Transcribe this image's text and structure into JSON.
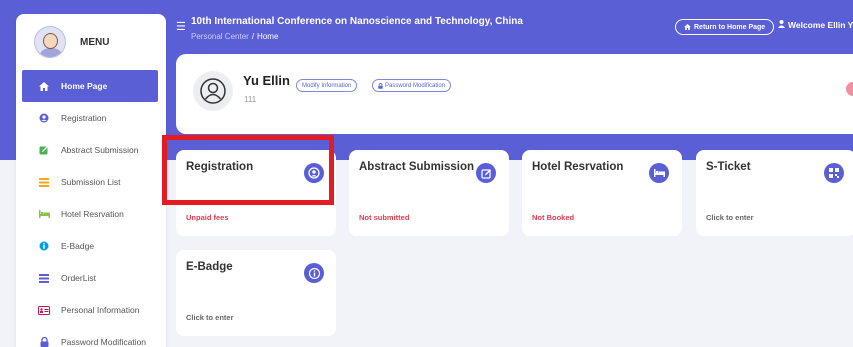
{
  "sidebar": {
    "menu_title": "MENU",
    "items": [
      {
        "label": "Home Page",
        "icon": "home-icon"
      },
      {
        "label": "Registration",
        "icon": "user-circle-icon"
      },
      {
        "label": "Abstract Submission",
        "icon": "edit-icon"
      },
      {
        "label": "Submission List",
        "icon": "list-icon"
      },
      {
        "label": "Hotel Resrvation",
        "icon": "bed-icon"
      },
      {
        "label": "E-Badge",
        "icon": "info-icon"
      },
      {
        "label": "OrderList",
        "icon": "list-icon"
      },
      {
        "label": "Personal Information",
        "icon": "id-card-icon"
      },
      {
        "label": "Password Modification",
        "icon": "lock-icon"
      }
    ]
  },
  "header": {
    "title": "10th International Conference on Nanoscience and Technology, China",
    "breadcrumb_root": "Personal Center",
    "breadcrumb_sep": "/",
    "breadcrumb_current": "Home",
    "return_button": "Return to Home Page",
    "welcome": "Welcome Ellin Yu"
  },
  "profile": {
    "name": "Yu Ellin",
    "id": "111",
    "modify_button": "Modify Information",
    "password_button": "Password Modification"
  },
  "cards": [
    {
      "title": "Registration",
      "status": "Unpaid fees",
      "icon": "user-circle-icon"
    },
    {
      "title": "Abstract Submission",
      "status": "Not submitted",
      "icon": "edit-icon"
    },
    {
      "title": "Hotel Resrvation",
      "status": "Not Booked",
      "icon": "bed-icon"
    },
    {
      "title": "S-Ticket",
      "status": "Click to enter",
      "icon": "qr-icon"
    },
    {
      "title": "E-Badge",
      "status": "Click to enter",
      "icon": "info-icon"
    }
  ],
  "colors": {
    "accent": "#5b5fd6",
    "status_red": "#e23b4e",
    "highlight": "#e21c22"
  }
}
